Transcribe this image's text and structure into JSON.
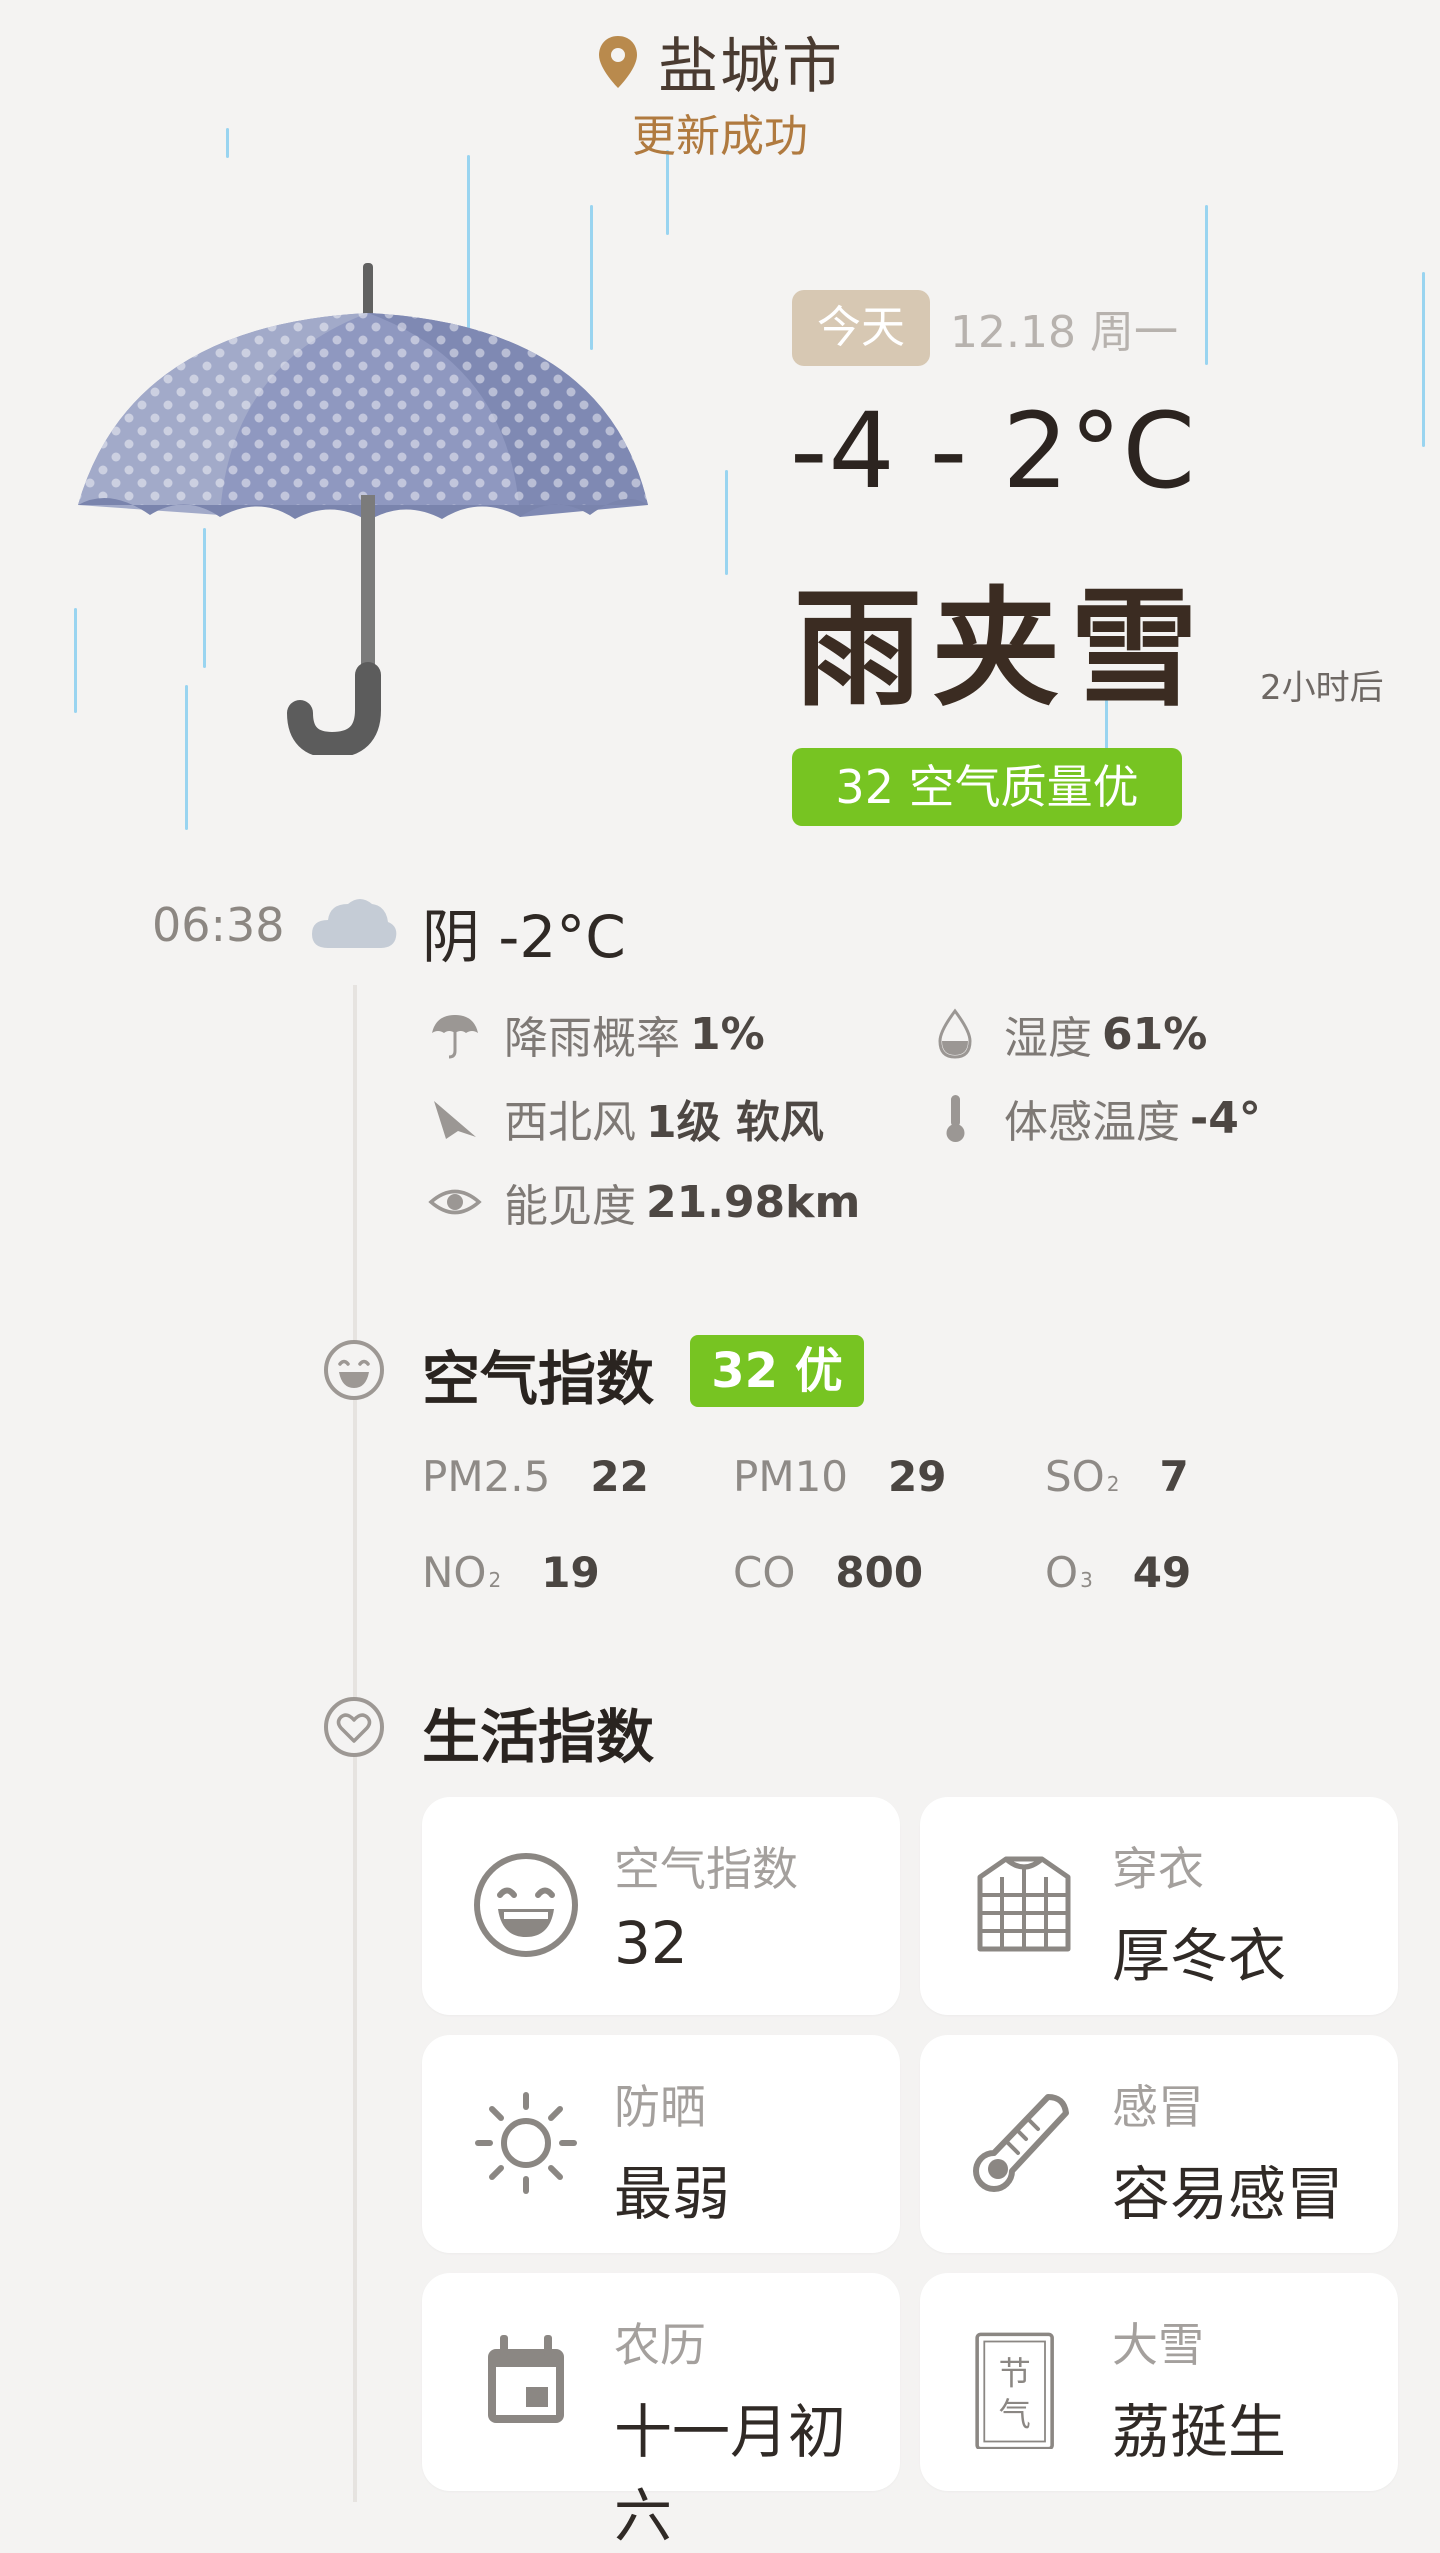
{
  "header": {
    "city": "盐城市",
    "status": "更新成功"
  },
  "today": {
    "badge": "今天",
    "date": "12.18 周一",
    "temp_range": "-4 - 2°C",
    "condition": "雨夹雪",
    "condition_time": "2小时后",
    "air_quality": "32 空气质量优"
  },
  "now": {
    "time": "06:38",
    "condition": "阴 -2°C",
    "details": {
      "rain_label": "降雨概率",
      "rain_value": "1%",
      "humidity_label": "湿度",
      "humidity_value": "61%",
      "wind_label": "西北风",
      "wind_value": "1级 软风",
      "feels_label": "体感温度",
      "feels_value": "-4°",
      "visibility_label": "能见度",
      "visibility_value": "21.98km"
    }
  },
  "air_index": {
    "title": "空气指数",
    "badge": "32 优",
    "pollutants": [
      {
        "name": "PM2.5",
        "sub": "",
        "value": "22"
      },
      {
        "name": "PM10",
        "sub": "",
        "value": "29"
      },
      {
        "name": "SO",
        "sub": "2",
        "value": "7"
      },
      {
        "name": "NO",
        "sub": "2",
        "value": "19"
      },
      {
        "name": "CO",
        "sub": "",
        "value": "800"
      },
      {
        "name": "O",
        "sub": "3",
        "value": "49"
      }
    ]
  },
  "life_index": {
    "title": "生活指数",
    "cards": [
      {
        "title": "空气指数",
        "value": "32",
        "icon": "smile-icon"
      },
      {
        "title": "穿衣",
        "value": "厚冬衣",
        "icon": "jacket-icon"
      },
      {
        "title": "防晒",
        "value": "最弱",
        "icon": "sun-icon"
      },
      {
        "title": "感冒",
        "value": "容易感冒",
        "icon": "thermometer-icon"
      },
      {
        "title": "农历",
        "value": "十一月初六",
        "icon": "calendar-icon"
      },
      {
        "title": "大雪",
        "value": "荔挺生",
        "icon": "solar-term-icon",
        "icon_text": "节气"
      }
    ]
  },
  "colors": {
    "accent_green": "#77c422",
    "badge_beige": "#d7c8b3",
    "status_brown": "#b07a3f",
    "rain_blue": "#8fd0ef"
  }
}
